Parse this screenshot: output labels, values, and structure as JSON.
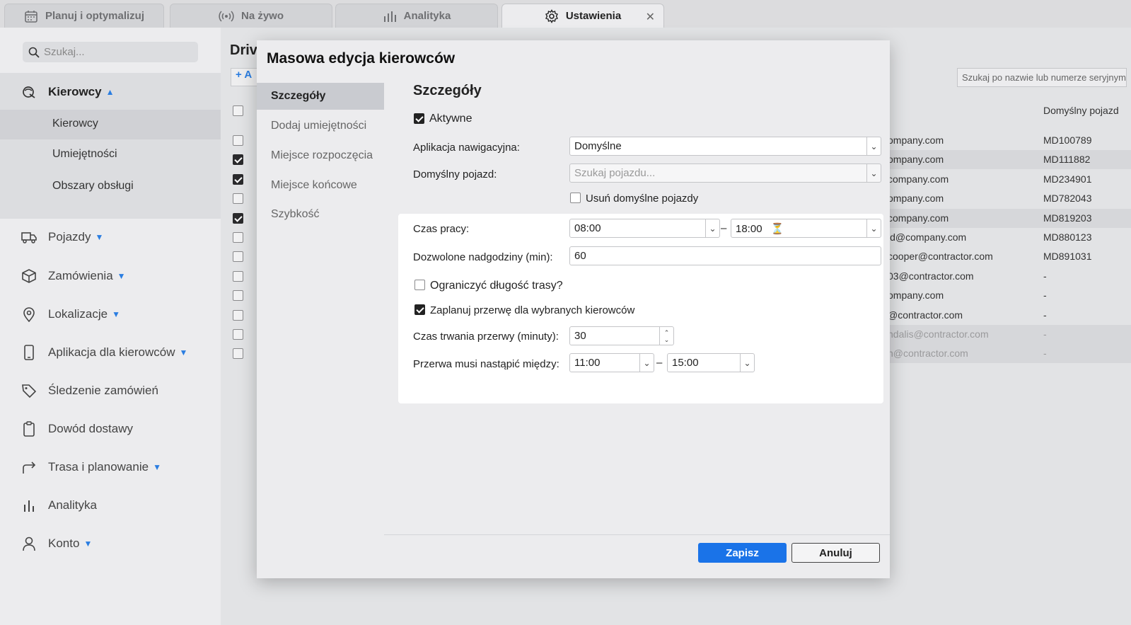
{
  "tabs": [
    {
      "label": "Planuj i optymalizuj",
      "icon": "calendar-icon"
    },
    {
      "label": "Na żywo",
      "icon": "live-broadcast-icon"
    },
    {
      "label": "Analityka",
      "icon": "bar-chart-icon"
    },
    {
      "label": "Ustawienia",
      "icon": "gear-icon",
      "active": true,
      "close": "✕"
    }
  ],
  "sidebar": {
    "search_placeholder": "Szukaj...",
    "items": [
      {
        "label": "Kierowcy",
        "icon": "drivers-icon",
        "expanded": true
      },
      {
        "label": "Pojazdy",
        "icon": "truck-icon"
      },
      {
        "label": "Zamówienia",
        "icon": "package-icon"
      },
      {
        "label": "Lokalizacje",
        "icon": "location-pin-icon"
      },
      {
        "label": "Aplikacja dla kierowców",
        "icon": "mobile-phone-icon"
      },
      {
        "label": "Śledzenie zamówień",
        "icon": "tag-icon"
      },
      {
        "label": "Dowód dostawy",
        "icon": "clipboard-icon"
      },
      {
        "label": "Trasa i planowanie",
        "icon": "route-arrow-icon"
      },
      {
        "label": "Analityka",
        "icon": "bar-chart-icon"
      },
      {
        "label": "Konto",
        "icon": "user-icon"
      }
    ],
    "subitems": [
      "Kierowcy",
      "Umiejętności",
      "Obszary obsługi"
    ]
  },
  "background": {
    "title_fragment": "Driv",
    "add_fragment": "A",
    "search_placeholder": "Szukaj po nazwie lub numerze seryjnym",
    "column_vehicle": "Domyślny pojazd",
    "rows": [
      {
        "email": "ompany.com",
        "vehicle": "MD100789",
        "checked": false
      },
      {
        "email": "ompany.com",
        "vehicle": "MD111882",
        "checked": true
      },
      {
        "email": "company.com",
        "vehicle": "MD234901",
        "checked": true
      },
      {
        "email": "ompany.com",
        "vehicle": "MD782043",
        "checked": false
      },
      {
        "email": "company.com",
        "vehicle": "MD819203",
        "checked": true
      },
      {
        "email": "id@company.com",
        "vehicle": "MD880123",
        "checked": false
      },
      {
        "email": "cooper@contractor.com",
        "vehicle": "MD891031",
        "checked": false
      },
      {
        "email": "03@contractor.com",
        "vehicle": "-",
        "checked": false
      },
      {
        "email": "ompany.com",
        "vehicle": "-",
        "checked": false
      },
      {
        "email": "@contractor.com",
        "vehicle": "-",
        "checked": false
      },
      {
        "email": "ndalis@contractor.com",
        "vehicle": "-",
        "checked": false
      },
      {
        "email": "n@contractor.com",
        "vehicle": "-",
        "checked": false
      }
    ]
  },
  "modal": {
    "title": "Masowa edycja kierowców",
    "nav": [
      "Szczegóły",
      "Dodaj umiejętności",
      "Miejsce rozpoczęcia",
      "Miejsce końcowe",
      "Szybkość"
    ],
    "section_title": "Szczegóły",
    "active_label": "Aktywne",
    "nav_app_label": "Aplikacja nawigacyjna:",
    "nav_app_value": "Domyślne",
    "default_vehicle_label": "Domyślny pojazd:",
    "default_vehicle_placeholder": "Szukaj pojazdu...",
    "remove_default_label": "Usuń domyślne pojazdy",
    "work_time_label": "Czas pracy:",
    "work_start": "08:00",
    "work_end": "18:00",
    "overtime_label": "Dozwolone nadgodziny (min):",
    "overtime_value": "60",
    "limit_route_label": "Ograniczyć długość trasy?",
    "plan_break_label": "Zaplanuj przerwę dla wybranych kierowców",
    "break_duration_label": "Czas trwania przerwy (minuty):",
    "break_duration_value": "30",
    "break_between_label": "Przerwa musi nastąpić między:",
    "break_start": "11:00",
    "break_end": "15:00",
    "dash": "–",
    "save": "Zapisz",
    "cancel": "Anuluj"
  }
}
